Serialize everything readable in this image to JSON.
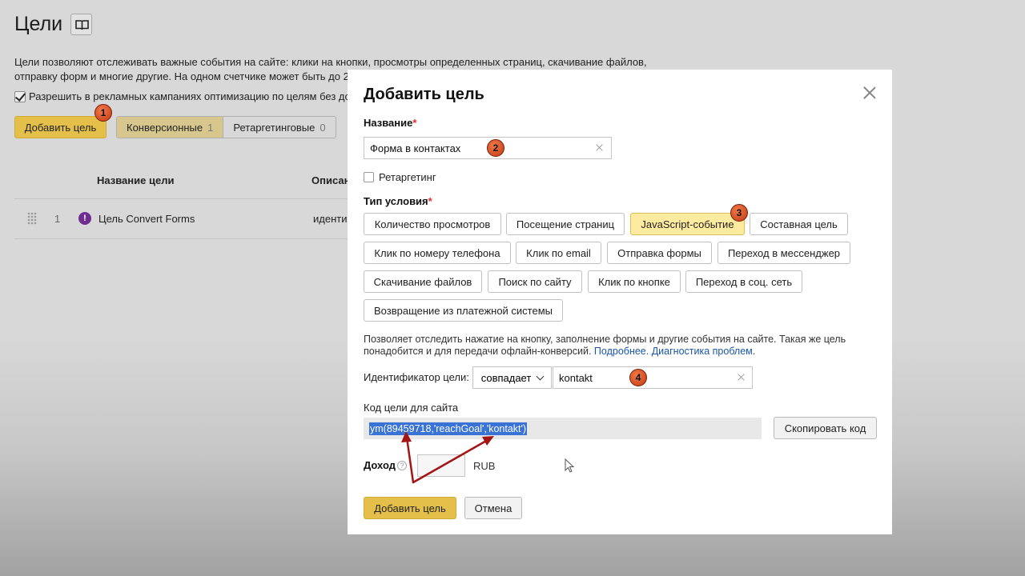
{
  "page": {
    "title": "Цели",
    "description": "Цели позволяют отслеживать важные события на сайте: клики на кнопки, просмотры определенных страниц, скачивание файлов, отправку форм и многие другие. На одном счетчике может быть до 2",
    "allow_label": "Разрешить в рекламных кампаниях оптимизацию по целям без до",
    "add_goal_label": "Добавить цель",
    "tabs": [
      {
        "label": "Конверсионные",
        "count": "1"
      },
      {
        "label": "Ретаргетинговые",
        "count": "0"
      }
    ],
    "table": {
      "headers": [
        "Название цели",
        "Описан"
      ],
      "rows": [
        {
          "index": "1",
          "name": "Цель Convert Forms",
          "desc": "иденти"
        }
      ]
    }
  },
  "modal": {
    "title": "Добавить цель",
    "name_label": "Название",
    "required_mark": "*",
    "name_value": "Форма в контактах",
    "retargeting_label": "Ретаргетинг",
    "condition_label": "Тип условия",
    "conditions": [
      "Количество просмотров",
      "Посещение страниц",
      "JavaScript-событие",
      "Составная цель",
      "Клик по номеру телефона",
      "Клик по email",
      "Отправка формы",
      "Переход в мессенджер",
      "Скачивание файлов",
      "Поиск по сайту",
      "Клик по кнопке",
      "Переход в соц. сеть",
      "Возвращение из платежной системы"
    ],
    "info_text": "Позволяет отследить нажатие на кнопку, заполнение формы и другие события на сайте. Такая же цель понадобится и для передачи офлайн-конверсий.",
    "info_link_more": "Подробнее.",
    "info_link_diag": "Диагностика проблем",
    "info_end": ".",
    "identifier_label": "Идентификатор цели:",
    "match_value": "совпадает",
    "identifier_value": "kontakt",
    "code_label": "Код цели для сайта",
    "code_value": "ym(89459718,'reachGoal','kontakt')",
    "copy_label": "Скопировать код",
    "income_label": "Доход",
    "help_glyph": "?",
    "currency": "RUB",
    "submit_label": "Добавить цель",
    "cancel_label": "Отмена"
  },
  "badges": [
    "1",
    "2",
    "3",
    "4"
  ],
  "warning_glyph": "!",
  "colors": {
    "accent_yellow": "#e4c04a",
    "active_condition": "#ffeba0",
    "link": "#1a56a8",
    "required": "#e52b2b",
    "annotation_arrow": "#a31515",
    "badge": "#d94a1f"
  }
}
